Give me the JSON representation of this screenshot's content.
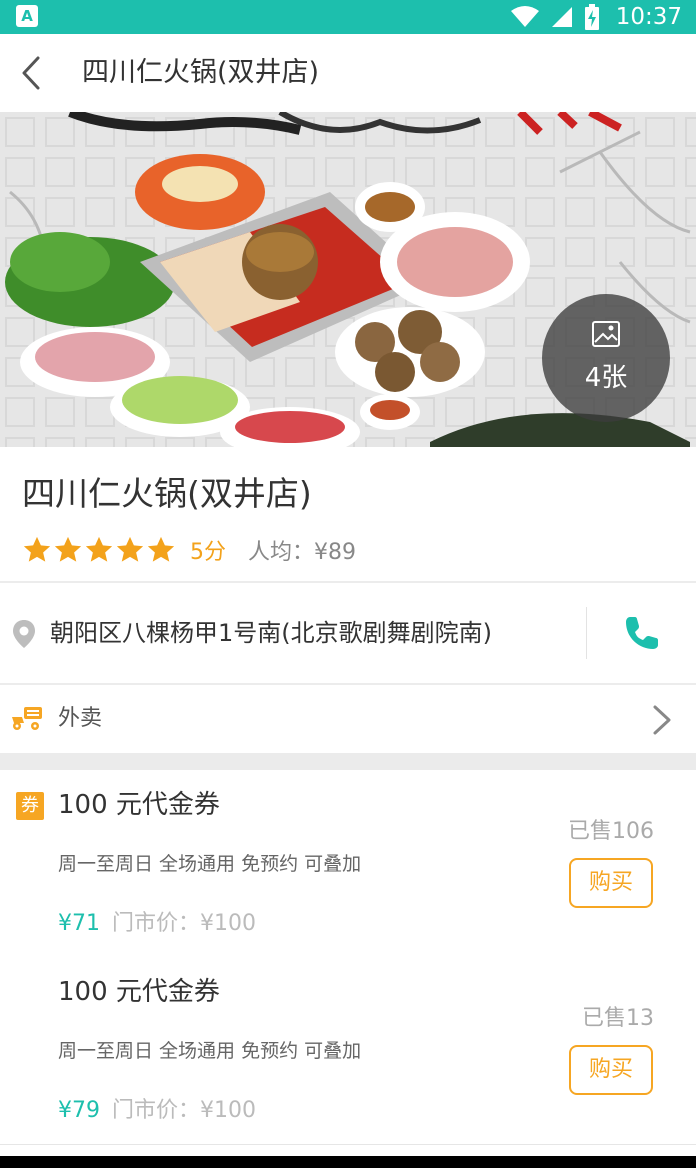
{
  "status_bar": {
    "app_icon_letter": "A",
    "time": "10:37",
    "icons": [
      "wifi-icon",
      "signal-icon",
      "battery-charging-icon"
    ]
  },
  "toolbar": {
    "title": "四川仁火锅(双井店)",
    "back_icon": "chevron-left-icon"
  },
  "hero": {
    "photo_count": "4张",
    "photo_icon": "image-icon"
  },
  "shop": {
    "name": "四川仁火锅(双井店)",
    "stars": 5,
    "score": "5分",
    "avg_price": "人均：¥89",
    "address": "朝阳区八棵杨甲1号南(北京歌剧舞剧院南)",
    "pin_icon": "location-pin-icon",
    "phone_icon": "phone-icon"
  },
  "delivery": {
    "label": "外卖",
    "icon": "delivery-scooter-icon",
    "chevron_icon": "chevron-right-icon"
  },
  "deals": [
    {
      "tag": "券",
      "title": "100 元代金券",
      "terms": "周一至周日  全场通用  免预约  可叠加",
      "price": "¥71",
      "original_price": "门市价：¥100",
      "sold": "已售106",
      "buy_label": "购买"
    },
    {
      "title": "100 元代金券",
      "terms": "周一至周日  全场通用  免预约  可叠加",
      "price": "¥79",
      "original_price": "门市价：¥100",
      "sold": "已售13",
      "buy_label": "购买"
    }
  ],
  "colors": {
    "accent": "#1dbfad",
    "rating": "#f3a21b",
    "buy": "#f6a623"
  }
}
